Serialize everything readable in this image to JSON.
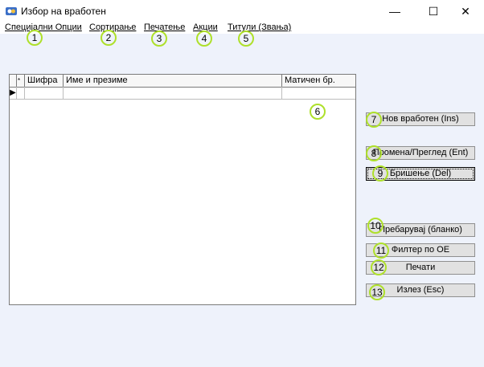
{
  "window": {
    "title": "Избор на вработен",
    "controls": {
      "minimize": "—",
      "maximize": "☐",
      "close": "✕"
    }
  },
  "menu": {
    "items": [
      {
        "label": "Специјални Опции"
      },
      {
        "label": "Сортирање"
      },
      {
        "label": "Печатење"
      },
      {
        "label": "Акции"
      },
      {
        "label": "Титули (Звања)"
      }
    ]
  },
  "grid": {
    "columns": [
      {
        "label": "*"
      },
      {
        "label": "Шифра"
      },
      {
        "label": "Име и презиме"
      },
      {
        "label": "Матичен бр."
      }
    ],
    "row_indicator": "▶"
  },
  "buttons": {
    "new": "Нов вработен (Ins)",
    "edit": "Промена/Преглед (Ent)",
    "delete": "Бришење (Del)",
    "search": "Пребарувај (бланко)",
    "filter": "Филтер по ОЕ",
    "print": "Печати",
    "exit": "Излез (Esc)"
  },
  "annotations": [
    "1",
    "2",
    "3",
    "4",
    "5",
    "6",
    "7",
    "8",
    "9",
    "10",
    "11",
    "12",
    "13"
  ],
  "colors": {
    "window_bg": "#eef2fb",
    "badge_ring": "#aee02a"
  }
}
